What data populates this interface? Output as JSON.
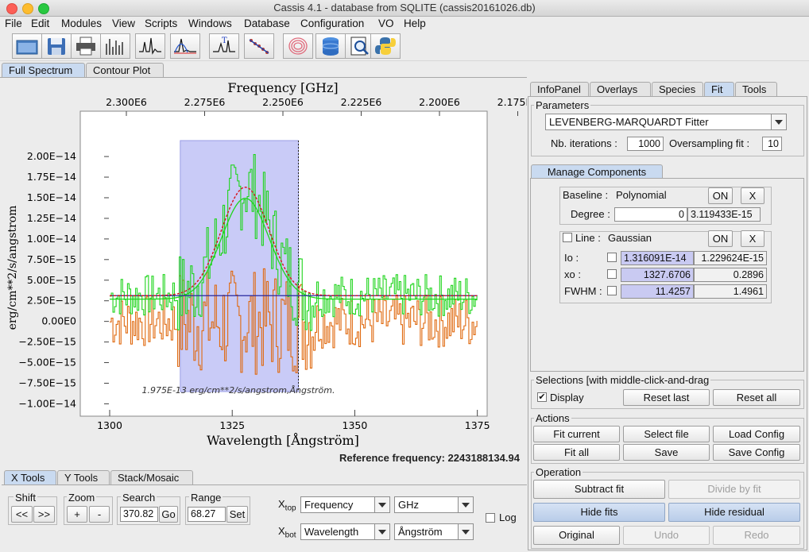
{
  "window": {
    "title": "Cassis 4.1 - database from SQLITE (cassis20161026.db)"
  },
  "menu": [
    "File",
    "Edit",
    "Modules",
    "View",
    "Scripts",
    "Windows",
    "Database",
    "Configuration",
    "VO",
    "Help"
  ],
  "toolbar_icons": [
    "open-folder-icon",
    "save-icon",
    "print-icon",
    "spectrum-lines-icon",
    "spectrum-peaks-icon",
    "spectrum-fit-icon",
    "spectrum-marker-icon",
    "line-analysis-icon",
    "rotational-diagram-icon",
    "database-icon",
    "ssap-search-icon",
    "python-icon"
  ],
  "main_tabs": [
    "Full Spectrum",
    "Contour Plot"
  ],
  "chart_data": {
    "type": "line",
    "top_axis_label": "Frequency [GHz]",
    "top_ticks": [
      "2.300E6",
      "2.275E6",
      "2.250E6",
      "2.225E6",
      "2.200E6",
      "2.175E6"
    ],
    "xlabel": "Wavelength [Ångström]",
    "x_ticks": [
      "1300",
      "1325",
      "1350",
      "1375"
    ],
    "xlim": [
      1294,
      1377
    ],
    "ylabel": "erg/cm**2/s/angstrom",
    "y_ticks": [
      "2.00E−14",
      "1.75E−14",
      "1.50E−14",
      "1.25E−14",
      "1.00E−14",
      "7.50E−15",
      "5.00E−15",
      "2.50E−15",
      "0.00E0",
      "−2.50E−15",
      "−5.00E−15",
      "−7.50E−15",
      "−1.00E−14"
    ],
    "ylim": [
      -1.15e-14,
      2.55e-14
    ],
    "selection_range": [
      1314.4,
      1338.5
    ],
    "annotation": "1.975E-13 erg/cm**2/s/angstrom,Ångström.",
    "fit_model": {
      "baseline": 3.119433e-15,
      "amplitude": 1.316091e-14,
      "center": 1327.6706,
      "fwhm": 11.4257
    },
    "series": [
      {
        "name": "Fit",
        "color": "#d8141c"
      },
      {
        "name": "Data",
        "color": "#1fd51c"
      },
      {
        "name": "Residual",
        "color": "#e06a10"
      },
      {
        "name": "Baseline",
        "color": "#27279f"
      }
    ]
  },
  "reference_frequency": "Reference frequency: 2243188134.94",
  "right_tabs": [
    "InfoPanel",
    "Overlays",
    "Species",
    "Fit",
    "Tools"
  ],
  "parameters": {
    "title": "Parameters",
    "fitter": "LEVENBERG-MARQUARDT Fitter",
    "iterations_label": "Nb. iterations :",
    "iterations": "1000",
    "oversampling_label": "Oversampling fit :",
    "oversampling": "10"
  },
  "components": {
    "tab": "Manage Components",
    "baseline": {
      "label": "Baseline :",
      "type": "Polynomial",
      "on": "ON",
      "remove": "X",
      "degree_label": "Degree :",
      "degree": "0",
      "value": "3.119433E-15"
    },
    "line": {
      "label": "Line :",
      "type": "Gaussian",
      "on": "ON",
      "remove": "X",
      "params": [
        {
          "name": "Io :",
          "value": "1.316091E-14",
          "error": "1.229624E-15"
        },
        {
          "name": "xo :",
          "value": "1327.6706",
          "error": "0.2896"
        },
        {
          "name": "FWHM :",
          "value": "11.4257",
          "error": "1.4961"
        }
      ]
    }
  },
  "selections": {
    "title": "Selections [with middle-click-and-drag",
    "display": "Display",
    "reset_last": "Reset last",
    "reset_all": "Reset all"
  },
  "actions": {
    "title": "Actions",
    "fit_current": "Fit current",
    "select_file": "Select file",
    "load_config": "Load Config",
    "fit_all": "Fit all",
    "save": "Save",
    "save_config": "Save Config"
  },
  "operation": {
    "title": "Operation",
    "subtract_fit": "Subtract fit",
    "divide_by_fit": "Divide by fit",
    "hide_fits": "Hide fits",
    "hide_residual": "Hide residual",
    "original": "Original",
    "undo": "Undo",
    "redo": "Redo"
  },
  "bottom_tabs": [
    "X Tools",
    "Y Tools",
    "Stack/Mosaic"
  ],
  "xtools": {
    "shift_label": "Shift",
    "shift_left": "<<",
    "shift_right": ">>",
    "zoom_label": "Zoom",
    "zoom_in": "+",
    "zoom_out": "-",
    "search_label": "Search",
    "search_value": "370.82",
    "go": "Go",
    "range_label": "Range",
    "range_value": "68.27",
    "set": "Set",
    "xtop_label": "X",
    "xtop_sub": "top",
    "xbot_sub": "bot",
    "xtop_axis": "Frequency",
    "xtop_unit": "GHz",
    "xbot_axis": "Wavelength",
    "xbot_unit": "Ångström",
    "log": "Log"
  }
}
